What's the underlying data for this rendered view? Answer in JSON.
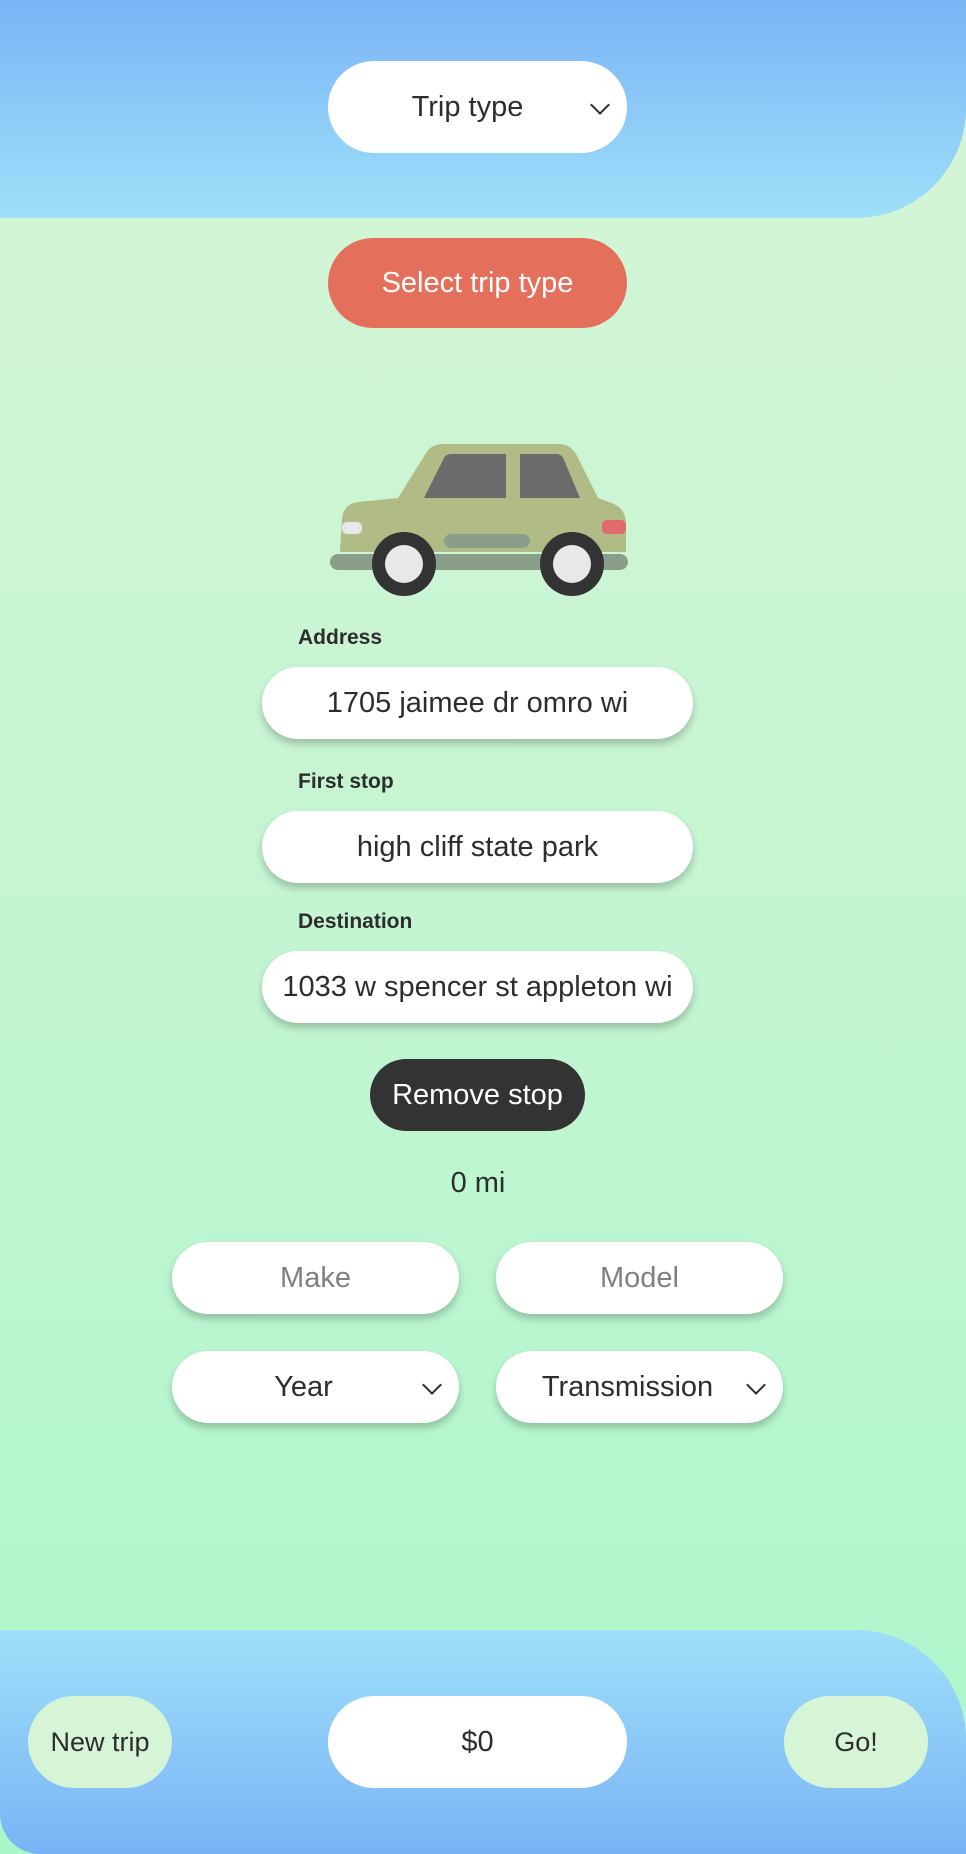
{
  "header": {
    "trip_type_label": "Trip type"
  },
  "trip": {
    "select_button_label": "Select trip type"
  },
  "illustration": {
    "icon": "car-icon",
    "colors": {
      "body": "#b0bb86",
      "window": "#6b6b6b",
      "wheel": "#333333",
      "hubcap": "#e8e8e8",
      "tail_light": "#e16b6b",
      "bumper": "#8a9f8a"
    }
  },
  "form": {
    "address": {
      "label": "Address",
      "value": "1705 jaimee dr omro wi"
    },
    "first_stop": {
      "label": "First stop",
      "value": "high cliff state park"
    },
    "destination": {
      "label": "Destination",
      "value": "1033 w spencer st appleton wi"
    },
    "remove_stop_label": "Remove stop",
    "distance": "0 mi"
  },
  "vehicle": {
    "make_placeholder": "Make",
    "model_placeholder": "Model",
    "year_label": "Year",
    "transmission_label": "Transmission"
  },
  "footer": {
    "new_trip_label": "New trip",
    "price": "$0",
    "go_label": "Go!"
  },
  "colors": {
    "accent_button": "#e4705c",
    "dark_button": "#333333",
    "band_top": "#7ab3f5",
    "band_light": "#9ee0fa",
    "background": "#d6f5d6"
  }
}
